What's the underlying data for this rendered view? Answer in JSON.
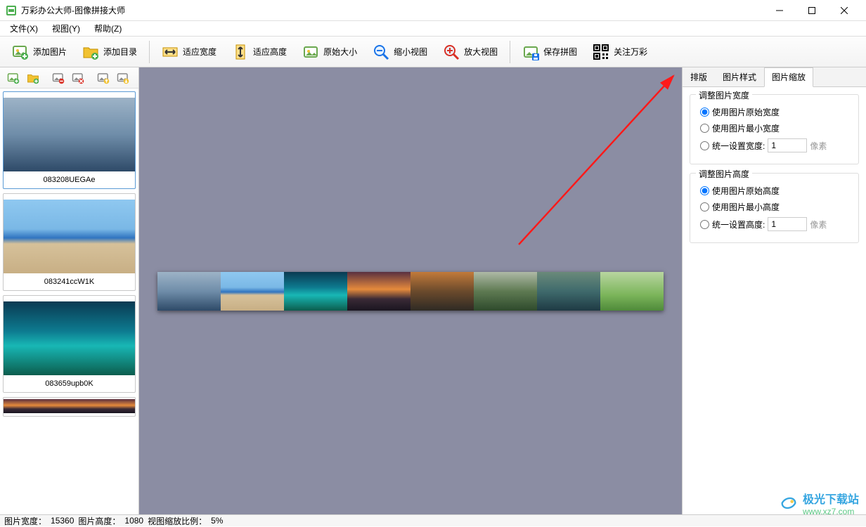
{
  "window": {
    "title": "万彩办公大师-图像拼接大师"
  },
  "menu": {
    "file": "文件(X)",
    "view": "视图(Y)",
    "help": "帮助(Z)"
  },
  "toolbar": {
    "addImage": "添加图片",
    "addFolder": "添加目录",
    "fitWidth": "适应宽度",
    "fitHeight": "适应高度",
    "origSize": "原始大小",
    "zoomOut": "缩小视图",
    "zoomIn": "放大视图",
    "save": "保存拼图",
    "about": "关注万彩"
  },
  "thumbs": [
    {
      "name": "083208UEGAe",
      "cls": "g-blue"
    },
    {
      "name": "083241ccW1K",
      "cls": "g-beach"
    },
    {
      "name": "083659upb0K",
      "cls": "g-teal"
    }
  ],
  "tabs": {
    "layout": "排版",
    "style": "图片样式",
    "scale": "图片缩放"
  },
  "panel": {
    "width": {
      "title": "调整图片宽度",
      "orig": "使用图片原始宽度",
      "min": "使用图片最小宽度",
      "uniform": "统一设置宽度:",
      "value": "1",
      "unit": "像素"
    },
    "height": {
      "title": "调整图片高度",
      "orig": "使用图片原始高度",
      "min": "使用图片最小高度",
      "uniform": "统一设置高度:",
      "value": "1",
      "unit": "像素"
    }
  },
  "status": {
    "width_label": "图片宽度：",
    "width_value": "15360",
    "height_label": "图片高度：",
    "height_value": "1080",
    "zoom_label": "视图缩放比例：",
    "zoom_value": "5%"
  },
  "watermark": {
    "brand": "极光下载站",
    "url": "www.xz7.com"
  }
}
